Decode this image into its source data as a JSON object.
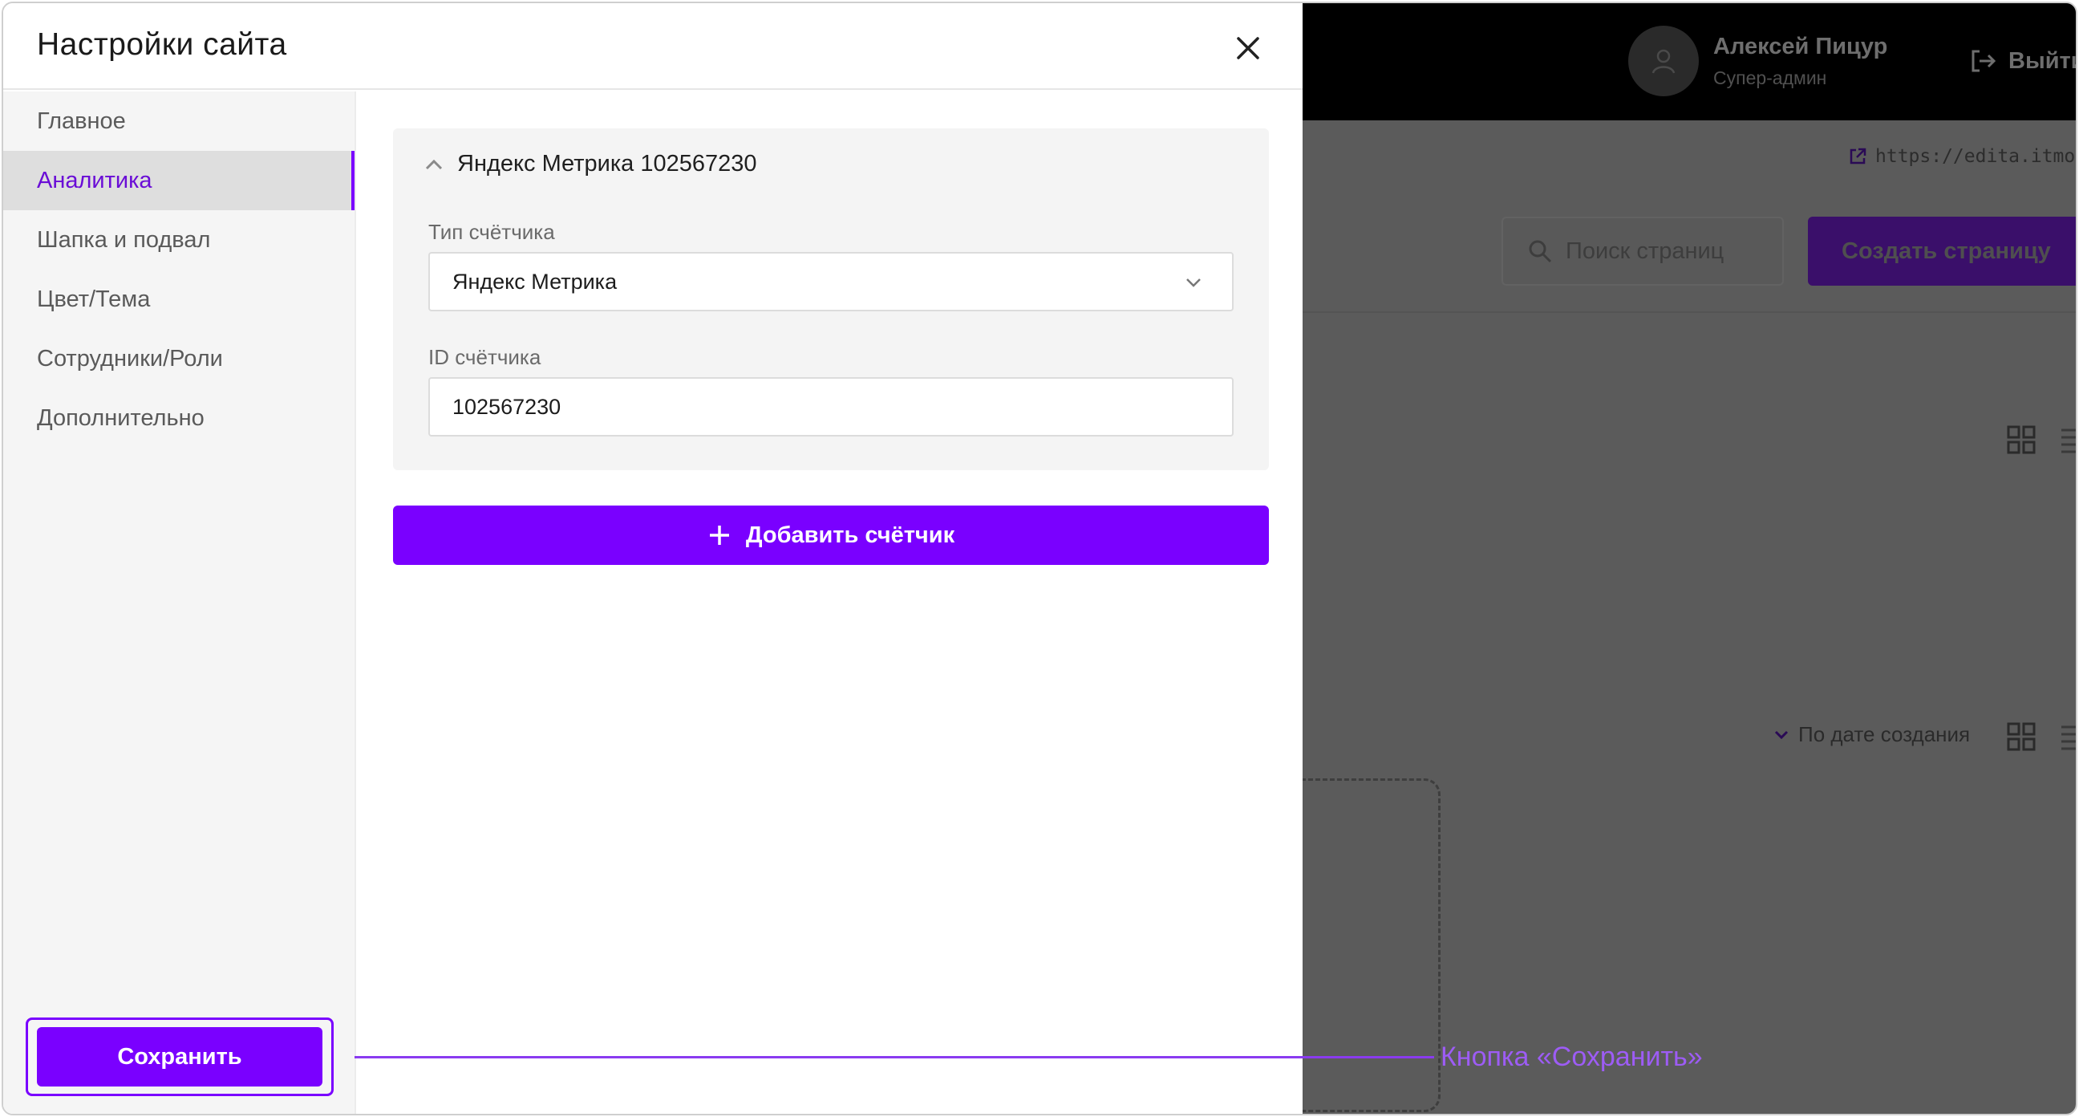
{
  "modal": {
    "title": "Настройки сайта",
    "close_icon": "close-icon"
  },
  "sidebar": {
    "items": [
      {
        "label": "Главное",
        "active": false
      },
      {
        "label": "Аналитика",
        "active": true
      },
      {
        "label": "Шапка и подвал",
        "active": false
      },
      {
        "label": "Цвет/Тема",
        "active": false
      },
      {
        "label": "Сотрудники/Роли",
        "active": false
      },
      {
        "label": "Дополнительно",
        "active": false
      }
    ],
    "save_label": "Сохранить"
  },
  "counter": {
    "title": "Яндекс Метрика 102567230",
    "type_label": "Тип счётчика",
    "type_value": "Яндекс Метрика",
    "id_label": "ID счётчика",
    "id_value": "102567230"
  },
  "add_counter_label": "Добавить счётчик",
  "background": {
    "user_name": "Алексей Пицур",
    "user_role": "Супер-админ",
    "logout_label": "Выйти",
    "site_link": "https://edita.itmo.ru/r",
    "search_placeholder": "Поиск страниц",
    "create_page_label": "Создать страницу",
    "sort_label": "По дате создания"
  },
  "annotation": {
    "label": "Кнопка «Сохранить»"
  },
  "colors": {
    "accent": "#7a00ff",
    "active_text": "#6a0dd6",
    "annotation": "#9d5cf5",
    "overlay": "#5b5b5b"
  }
}
